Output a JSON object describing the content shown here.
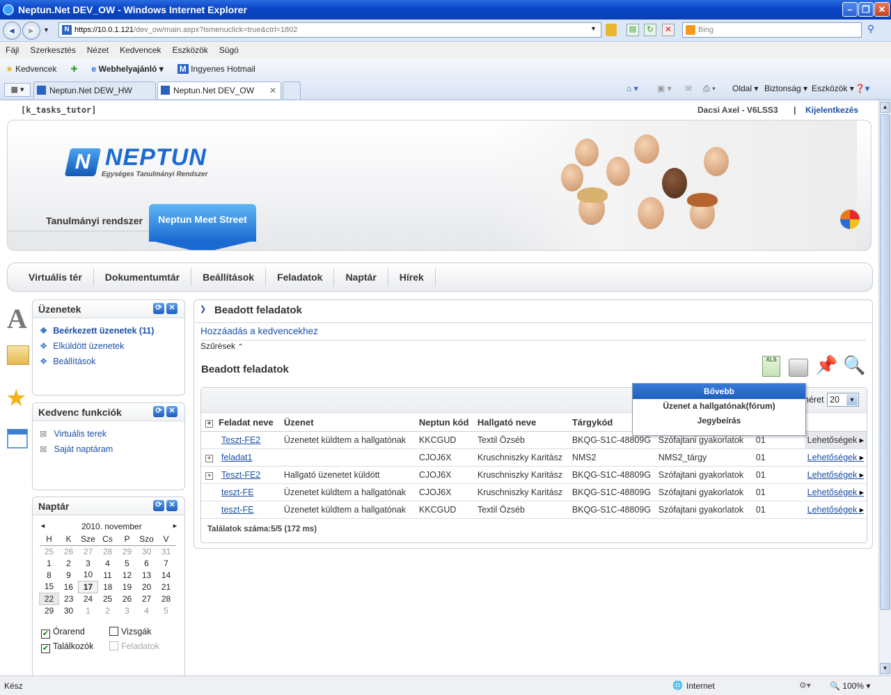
{
  "window": {
    "title": "Neptun.Net DEV_OW - Windows Internet Explorer"
  },
  "address": {
    "host": "https://10.0.1.121",
    "path": "/dev_ow/main.aspx?ismenuclick=true&ctrl=1802",
    "search_placeholder": "Bing"
  },
  "menu": [
    "Fájl",
    "Szerkesztés",
    "Nézet",
    "Kedvencek",
    "Eszközök",
    "Súgó"
  ],
  "favorites": {
    "label": "Kedvencek",
    "items": [
      "Webhelyajánló",
      "Ingyenes Hotmail"
    ]
  },
  "tabs": [
    "Neptun.Net DEW_HW",
    "Neptun.Net DEV_OW"
  ],
  "commandbar": [
    "Oldal",
    "Biztonság",
    "Eszközök"
  ],
  "page": {
    "role": "[k_tasks_tutor]",
    "user": "Dacsi Axel - V6LSS3",
    "sep": "|",
    "logout": "Kijelentkezés",
    "logo": {
      "name": "NEPTUN",
      "subtitle": "Egységes Tanulmányi Rendszer"
    },
    "system_tabs": [
      "Tanulmányi rendszer",
      "Neptun Meet Street"
    ],
    "nav": [
      "Virtuális tér",
      "Dokumentumtár",
      "Beállítások",
      "Feladatok",
      "Naptár",
      "Hírek"
    ]
  },
  "messages_box": {
    "title": "Üzenetek",
    "items": [
      "Beérkezett üzenetek (11)",
      "Elküldött üzenetek",
      "Beállítások"
    ]
  },
  "fav_box": {
    "title": "Kedvenc funkciók",
    "items": [
      "Virtuális terek",
      "Saját naptáram"
    ]
  },
  "calendar_box": {
    "title": "Naptár",
    "month": "2010. november",
    "prev": "◄",
    "next": "►",
    "days": [
      "H",
      "K",
      "Sze",
      "Cs",
      "P",
      "Szo",
      "V"
    ],
    "weeks": [
      [
        "25",
        "26",
        "27",
        "28",
        "29",
        "30",
        "31"
      ],
      [
        "1",
        "2",
        "3",
        "4",
        "5",
        "6",
        "7"
      ],
      [
        "8",
        "9",
        "10",
        "11",
        "12",
        "13",
        "14"
      ],
      [
        "15",
        "16",
        "17",
        "18",
        "19",
        "20",
        "21"
      ],
      [
        "22",
        "23",
        "24",
        "25",
        "26",
        "27",
        "28"
      ],
      [
        "29",
        "30",
        "1",
        "2",
        "3",
        "4",
        "5"
      ]
    ],
    "filters": [
      {
        "label": "Órarend",
        "checked": true
      },
      {
        "label": "Vizsgák",
        "checked": false
      },
      {
        "label": "Találkozók",
        "checked": true
      },
      {
        "label": "Feladatok",
        "checked": false
      }
    ]
  },
  "main": {
    "title": "Beadott feladatok",
    "add_fav": "Hozzáadás a kedvencekhez",
    "filters": "Szűrések",
    "grid_title": "Beadott feladatok",
    "page_size_label": "néret",
    "page_size": "20",
    "columns": [
      "Feladat neve",
      "Üzenet",
      "Neptun kód",
      "Hallgató neve",
      "Tárgykód",
      "",
      ""
    ],
    "rows": [
      [
        "Teszt-FE2",
        "Üzenetet küldtem a hallgatónak",
        "KKCGUD",
        "Textil Özséb",
        "BKQG-S1C-48809G",
        "Szófajtani gyakorlatok",
        "01",
        "Lehetőségek"
      ],
      [
        "feladat1",
        "",
        "CJOJ6X",
        "Kruschniszky Karitász",
        "NMS2",
        "NMS2_tárgy",
        "01",
        "Lehetőségek"
      ],
      [
        "Teszt-FE2",
        "Hallgató üzenetet küldött",
        "CJOJ6X",
        "Kruschniszky Karitász",
        "BKQG-S1C-48809G",
        "Szófajtani gyakorlatok",
        "01",
        "Lehetőségek"
      ],
      [
        "teszt-FE",
        "Üzenetet küldtem a hallgatónak",
        "CJOJ6X",
        "Kruschniszky Karitász",
        "BKQG-S1C-48809G",
        "Szófajtani gyakorlatok",
        "01",
        "Lehetőségek"
      ],
      [
        "teszt-FE",
        "Üzenetet küldtem a hallgatónak",
        "KKCGUD",
        "Textil Özséb",
        "BKQG-S1C-48809G",
        "Szófajtani gyakorlatok",
        "01",
        "Lehetőségek"
      ]
    ],
    "expandable": [
      false,
      true,
      true,
      false,
      false
    ],
    "result_count": "Találatok száma:5/5 (172 ms)",
    "popup": [
      "Bővebb",
      "Üzenet a hallgatónak(fórum)",
      "Jegybeírás"
    ]
  },
  "status": {
    "left": "Kész",
    "zone": "Internet",
    "zoom": "100%"
  }
}
